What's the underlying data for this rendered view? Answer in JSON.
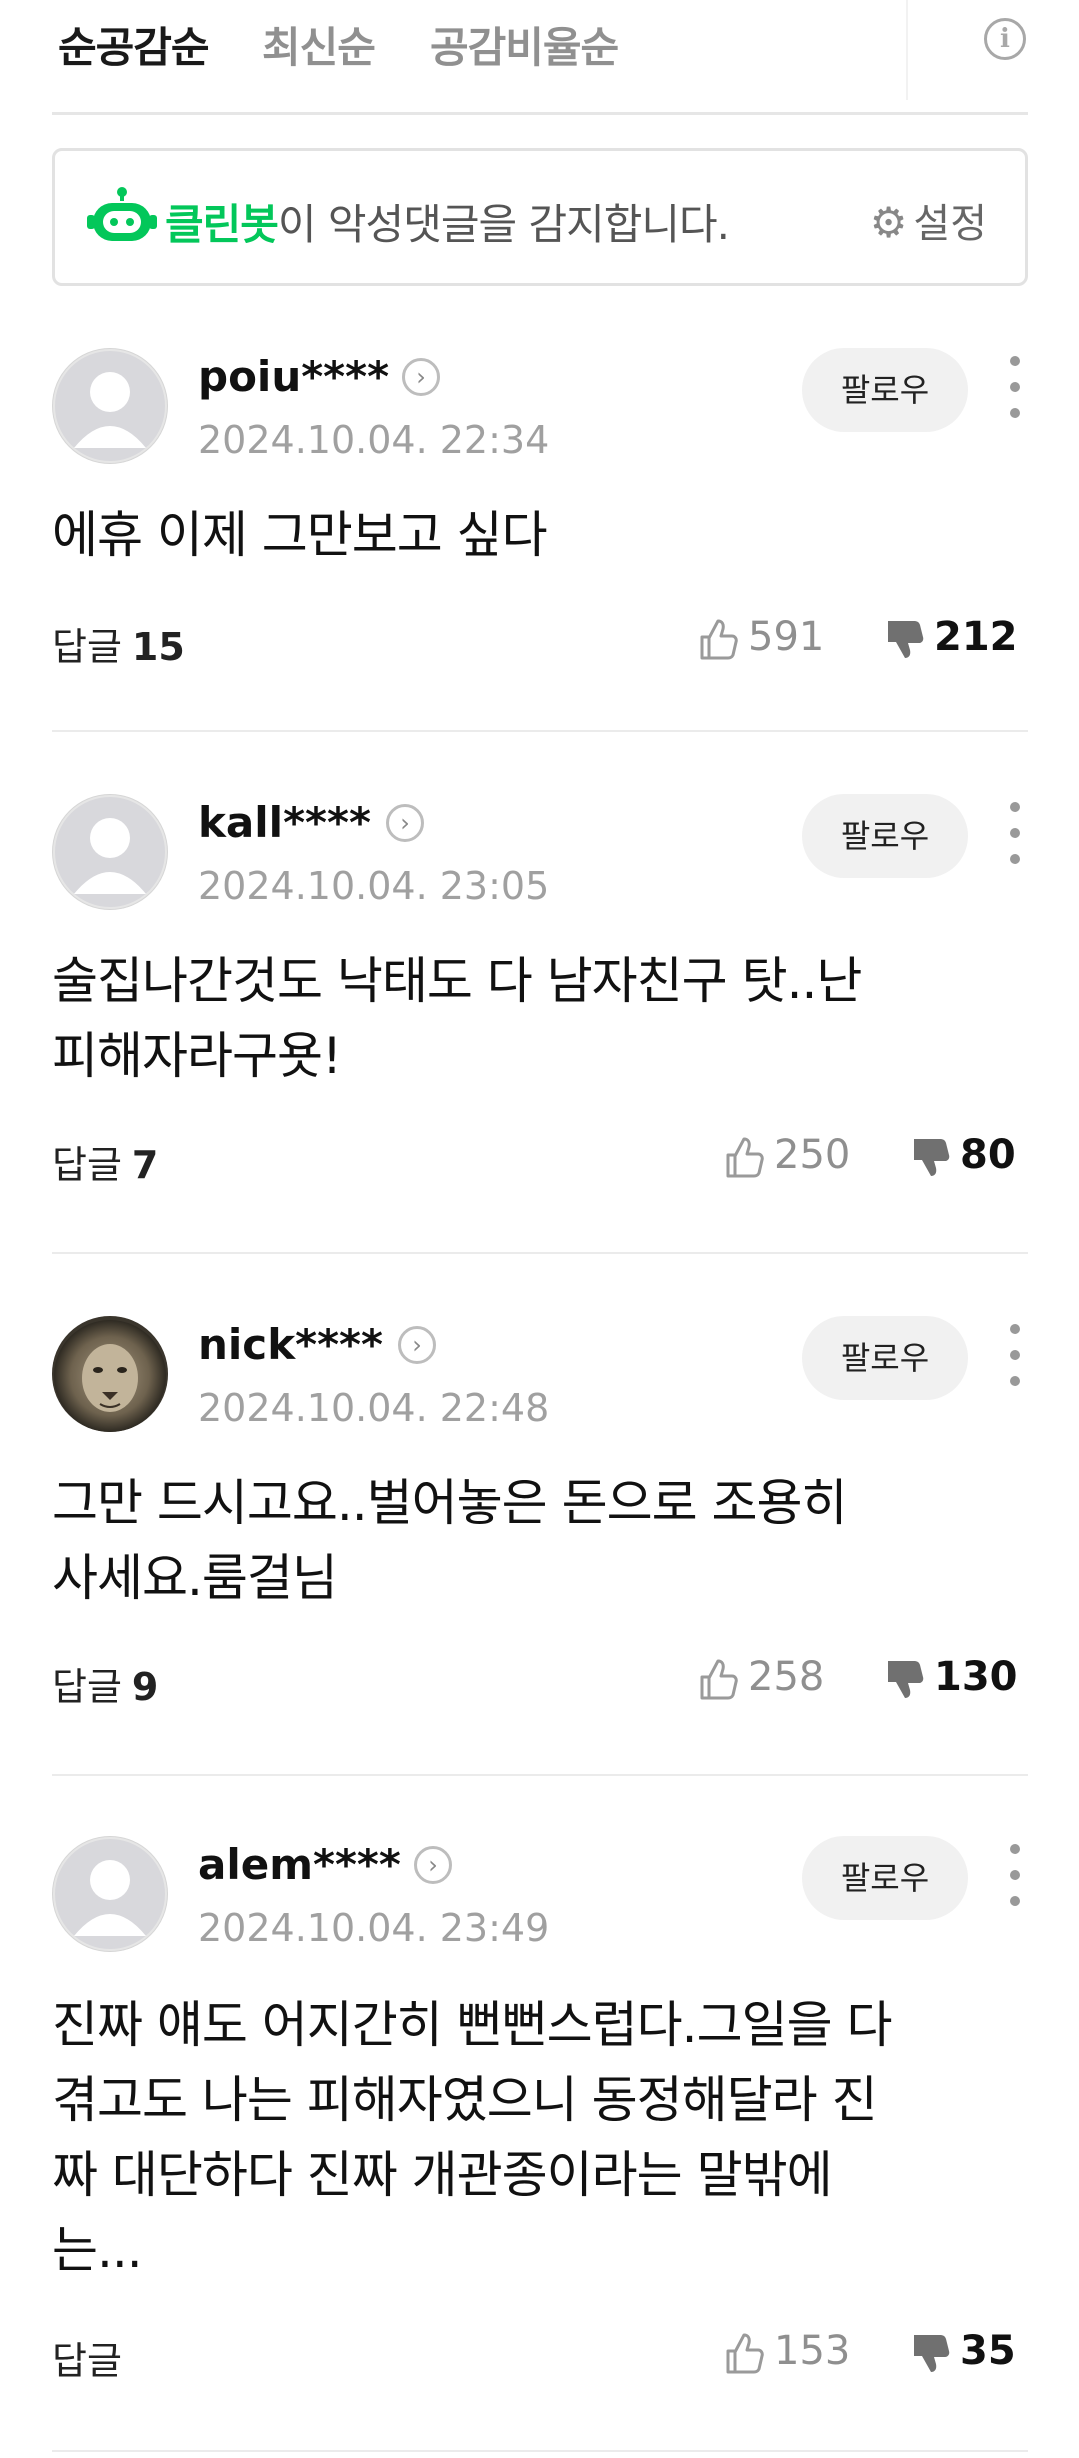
{
  "sort_tabs": [
    "순공감순",
    "최신순",
    "공감비율순"
  ],
  "cleanbot": {
    "brand": "클린봇",
    "message": "이 악성댓글을 감지합니다.",
    "settings_label": "설정",
    "brand_color": "#03c75a"
  },
  "comments": [
    {
      "username": "poiu****",
      "timestamp": "2024.10.04. 22:34",
      "text_lines": [
        "에휴 이제 그만보고 싶다"
      ],
      "reply_label": "답글",
      "reply_count": "15",
      "likes": "591",
      "dislikes": "212",
      "follow_label": "팔로우",
      "avatar": "default-avatar"
    },
    {
      "username": "kall****",
      "timestamp": "2024.10.04. 23:05",
      "text_lines": [
        "술집나간것도 낙태도 다 남자친구 탓..난",
        "피해자라구욧!"
      ],
      "reply_label": "답글",
      "reply_count": "7",
      "likes": "250",
      "dislikes": "80",
      "follow_label": "팔로우",
      "avatar": "default-avatar"
    },
    {
      "username": "nick****",
      "timestamp": "2024.10.04. 22:48",
      "text_lines": [
        "그만 드시고요..벌어놓은 돈으로 조용히",
        "사세요.룸걸님"
      ],
      "reply_label": "답글",
      "reply_count": "9",
      "likes": "258",
      "dislikes": "130",
      "follow_label": "팔로우",
      "avatar": "lion-photo"
    },
    {
      "username": "alem****",
      "timestamp": "2024.10.04. 23:49",
      "text_lines": [
        "진짜 얘도 어지간히 뻔뻔스럽다.그일을 다",
        "겪고도 나는 피해자였으니 동정해달라 진",
        "짜 대단하다 진짜 개관종이라는 말밖에",
        "는..."
      ],
      "reply_label": "답글",
      "reply_count": "",
      "likes": "153",
      "dislikes": "35",
      "follow_label": "팔로우",
      "avatar": "default-avatar"
    }
  ]
}
